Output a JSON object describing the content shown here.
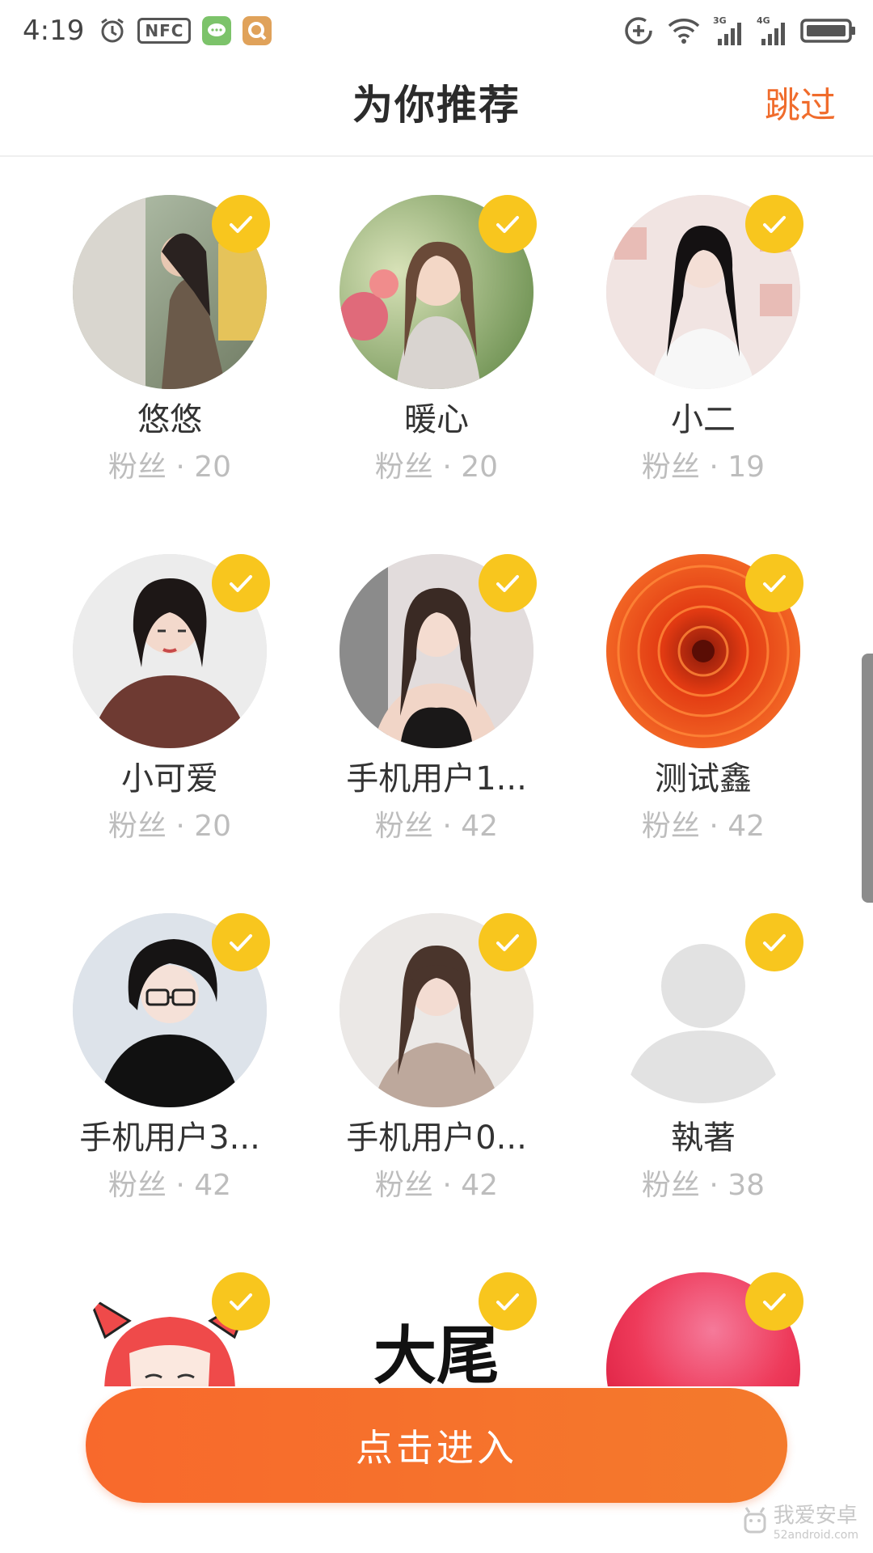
{
  "status_bar": {
    "time": "4:19",
    "nfc_label": "NFC",
    "left_icons": [
      "alarm-icon",
      "nfc-icon",
      "message-app-icon",
      "search-app-icon"
    ],
    "right_icons": [
      "data-saver-icon",
      "wifi-icon",
      "signal-3g-icon",
      "signal-4g-icon",
      "battery-icon"
    ],
    "signal_labels": [
      "3G",
      "4G"
    ]
  },
  "header": {
    "title": "为你推荐",
    "skip_label": "跳过"
  },
  "colors": {
    "accent": "#f06c2c",
    "button": "#f8692c",
    "check": "#f8c61e",
    "muted": "#bdbdbd"
  },
  "users": [
    {
      "name": "悠悠",
      "fans": "粉丝 · 20",
      "avatar": "photo-woman-standing",
      "selected": true
    },
    {
      "name": "暖心",
      "fans": "粉丝 · 20",
      "avatar": "photo-woman-garden",
      "selected": true
    },
    {
      "name": "小二",
      "fans": "粉丝 · 19",
      "avatar": "photo-woman-long-hair",
      "selected": true
    },
    {
      "name": "小可爱",
      "fans": "粉丝 · 20",
      "avatar": "photo-woman-short-hair",
      "selected": true
    },
    {
      "name": "手机用户1...",
      "fans": "粉丝 · 42",
      "avatar": "photo-woman-selfie",
      "selected": true
    },
    {
      "name": "测试鑫",
      "fans": "粉丝 · 42",
      "avatar": "photo-red-flower",
      "selected": true
    },
    {
      "name": "手机用户3...",
      "fans": "粉丝 · 42",
      "avatar": "illustration-girl-glasses",
      "selected": true
    },
    {
      "name": "手机用户0...",
      "fans": "粉丝 · 42",
      "avatar": "photo-woman-bangs",
      "selected": true
    },
    {
      "name": "執著",
      "fans": "粉丝 · 38",
      "avatar": "default-user-icon",
      "selected": true
    },
    {
      "name": "",
      "fans": "",
      "avatar": "anime-girl-red-hair",
      "selected": true
    },
    {
      "name": "",
      "fans": "",
      "avatar": "logo-text",
      "logo_text": "大尾",
      "selected": true
    },
    {
      "name": "",
      "fans": "",
      "avatar": "red-gradient-sphere",
      "selected": true
    }
  ],
  "enter_button": {
    "label": "点击进入"
  },
  "watermark": {
    "label": "我爱安卓",
    "sub": "52android.com"
  }
}
